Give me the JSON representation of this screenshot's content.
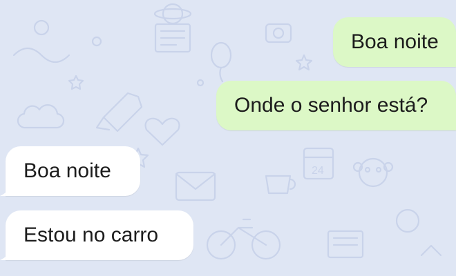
{
  "chat": {
    "colors": {
      "background": "#dfe6f4",
      "outgoing_bubble": "#dcf8c6",
      "incoming_bubble": "#ffffff"
    },
    "messages": [
      {
        "direction": "outgoing",
        "text": "Boa noite"
      },
      {
        "direction": "outgoing",
        "text": "Onde o senhor está?"
      },
      {
        "direction": "incoming",
        "text": "Boa noite"
      },
      {
        "direction": "incoming",
        "text": "Estou no carro"
      }
    ],
    "wallpaper_icons": [
      "rocket-icon",
      "planet-icon",
      "heart-icon",
      "envelope-icon",
      "star-icon",
      "bicycle-icon",
      "newspaper-icon",
      "camera-icon",
      "calendar-icon",
      "monkey-icon",
      "cloud-icon",
      "coffee-icon",
      "balloon-icon"
    ]
  }
}
